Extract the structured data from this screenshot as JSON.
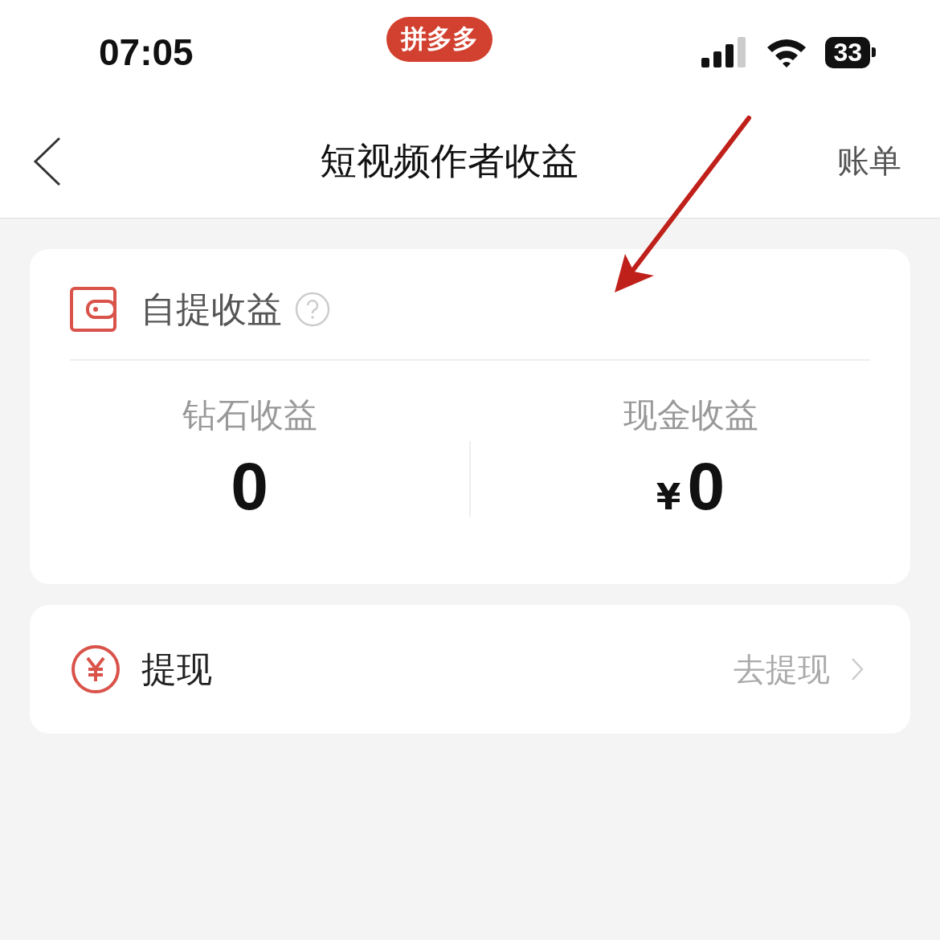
{
  "status_bar": {
    "time": "07:05",
    "badge": "拼多多",
    "battery": "33"
  },
  "nav": {
    "title": "短视频作者收益",
    "action": "账单"
  },
  "income_card": {
    "title": "自提收益",
    "columns": [
      {
        "label": "钻石收益",
        "value": "0"
      },
      {
        "label": "现金收益",
        "currency": "¥",
        "value": "0"
      }
    ]
  },
  "withdraw": {
    "label": "提现",
    "action": "去提现"
  }
}
